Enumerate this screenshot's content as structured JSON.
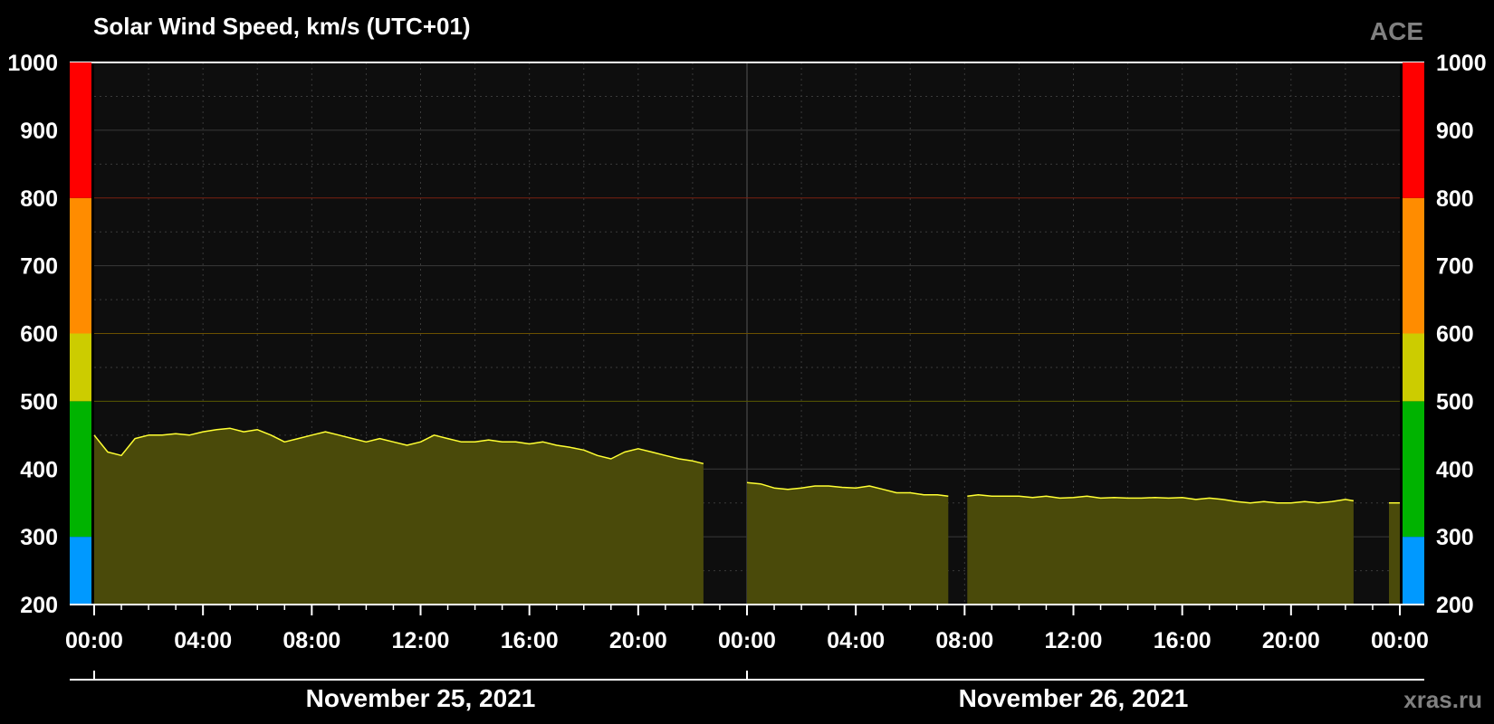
{
  "chart_data": {
    "type": "area",
    "title": "Solar Wind Speed, km/s (UTC+01)",
    "source": "ACE",
    "watermark": "xras.ru",
    "ylim": [
      200,
      1000
    ],
    "y_ticks": [
      200,
      300,
      400,
      500,
      600,
      700,
      800,
      900,
      1000
    ],
    "x_range_hours": [
      0,
      48
    ],
    "x_ticks": [
      {
        "h": 0,
        "label": "00:00"
      },
      {
        "h": 4,
        "label": "04:00"
      },
      {
        "h": 8,
        "label": "08:00"
      },
      {
        "h": 12,
        "label": "12:00"
      },
      {
        "h": 16,
        "label": "16:00"
      },
      {
        "h": 20,
        "label": "20:00"
      },
      {
        "h": 24,
        "label": "00:00"
      },
      {
        "h": 28,
        "label": "04:00"
      },
      {
        "h": 32,
        "label": "08:00"
      },
      {
        "h": 36,
        "label": "12:00"
      },
      {
        "h": 40,
        "label": "16:00"
      },
      {
        "h": 44,
        "label": "20:00"
      },
      {
        "h": 48,
        "label": "00:00"
      }
    ],
    "dates": [
      {
        "label": "November 25, 2021",
        "center_h": 12
      },
      {
        "label": "November 26, 2021",
        "center_h": 36
      }
    ],
    "grid": true,
    "level_bands": [
      {
        "from": 200,
        "to": 300,
        "color": "#0099ff"
      },
      {
        "from": 300,
        "to": 500,
        "color": "#00b300"
      },
      {
        "from": 500,
        "to": 600,
        "color": "#cccc00"
      },
      {
        "from": 600,
        "to": 800,
        "color": "#ff8c00"
      },
      {
        "from": 800,
        "to": 1000,
        "color": "#ff0000"
      }
    ],
    "colors": {
      "line": "#ffff33",
      "fill": "#4a4a0a",
      "plot_bg": "#0e0e0e",
      "grid": "#444444",
      "source_label": "#808080"
    },
    "series": [
      {
        "segments": [
          {
            "x": [
              0.0,
              0.5,
              1.0,
              1.5,
              2.0,
              2.5,
              3.0,
              3.5,
              4.0,
              4.5,
              5.0,
              5.5,
              6.0,
              6.5,
              7.0,
              7.5,
              8.0,
              8.5,
              9.0,
              9.5,
              10.0,
              10.5,
              11.0,
              11.5,
              12.0,
              12.5,
              13.0,
              13.5,
              14.0,
              14.5,
              15.0,
              15.5,
              16.0,
              16.5,
              17.0,
              17.5,
              18.0,
              18.5,
              19.0,
              19.5,
              20.0,
              20.5,
              21.0,
              21.5,
              22.0,
              22.4
            ],
            "y": [
              450,
              425,
              420,
              445,
              450,
              450,
              452,
              450,
              455,
              458,
              460,
              455,
              458,
              450,
              440,
              445,
              450,
              455,
              450,
              445,
              440,
              445,
              440,
              435,
              440,
              450,
              445,
              440,
              440,
              443,
              440,
              440,
              437,
              440,
              435,
              432,
              428,
              420,
              415,
              425,
              430,
              425,
              420,
              415,
              412,
              408
            ]
          }
        ]
      },
      {
        "segments": [
          {
            "x": [
              24.0,
              24.5,
              25.0,
              25.5,
              26.0,
              26.5,
              27.0,
              27.5,
              28.0,
              28.5,
              29.0,
              29.5,
              30.0,
              30.5,
              31.0,
              31.4
            ],
            "y": [
              380,
              378,
              372,
              370,
              372,
              375,
              375,
              373,
              372,
              375,
              370,
              365,
              365,
              362,
              362,
              360
            ]
          },
          {
            "x": [
              32.1,
              32.5,
              33.0,
              33.5,
              34.0,
              34.5,
              35.0,
              35.5,
              36.0,
              36.5,
              37.0,
              37.5,
              38.0,
              38.5,
              39.0,
              39.5,
              40.0,
              40.5,
              41.0,
              41.5,
              42.0,
              42.5,
              43.0,
              43.5,
              44.0,
              44.5,
              45.0,
              45.5,
              46.0,
              46.3
            ],
            "y": [
              360,
              362,
              360,
              360,
              360,
              358,
              360,
              357,
              358,
              360,
              357,
              358,
              357,
              357,
              358,
              357,
              358,
              355,
              357,
              355,
              352,
              350,
              352,
              350,
              350,
              352,
              350,
              352,
              355,
              353
            ]
          },
          {
            "x": [
              47.6,
              48.0
            ],
            "y": [
              350,
              350
            ]
          }
        ]
      }
    ]
  }
}
